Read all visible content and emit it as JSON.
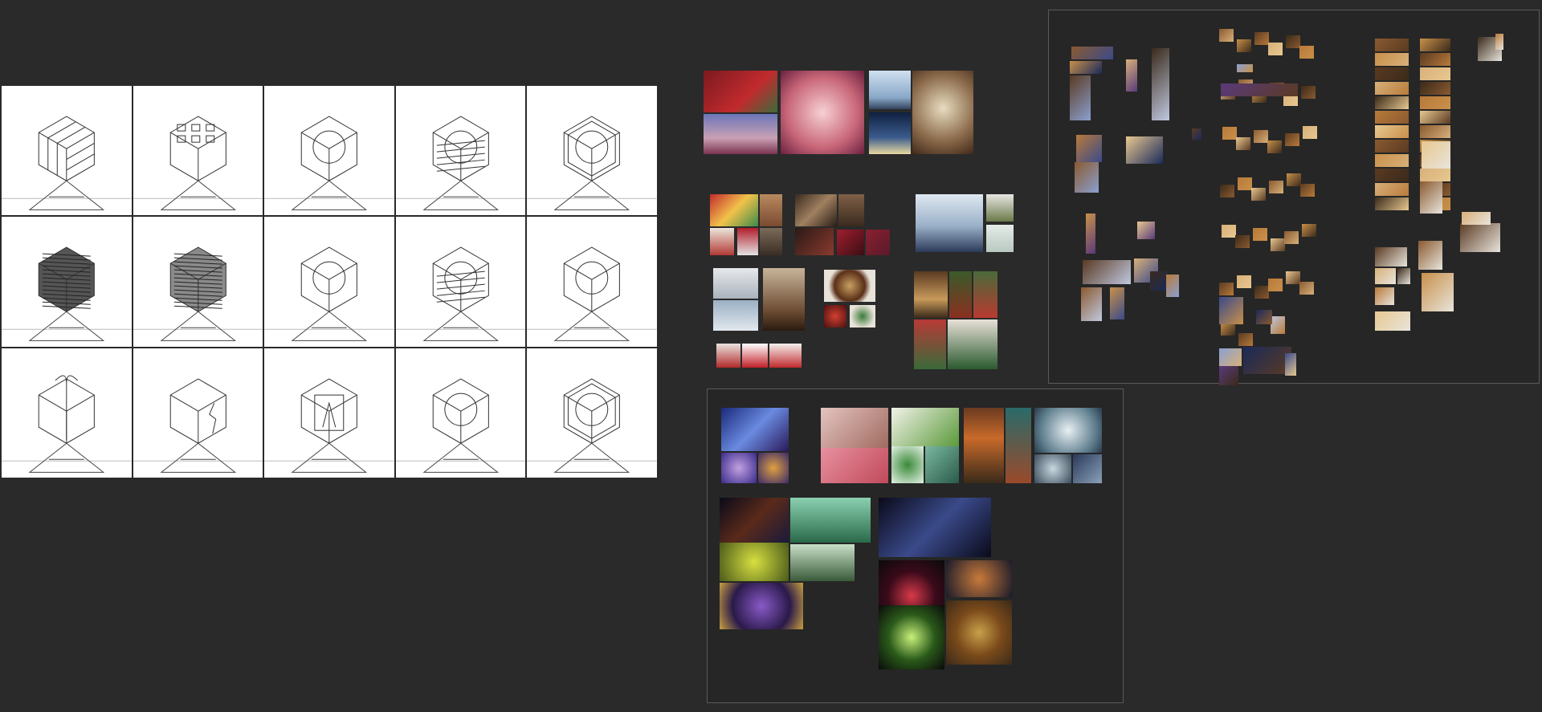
{
  "canvas": {
    "background": "#2a2a2a"
  },
  "sketch_grid": {
    "rows": 3,
    "cols": 5,
    "variants": [
      {
        "style": "rubik"
      },
      {
        "style": "blocks"
      },
      {
        "style": "sphere"
      },
      {
        "style": "sphere-lines"
      },
      {
        "style": "sphere-hex"
      },
      {
        "style": "maze-dark"
      },
      {
        "style": "maze-mid"
      },
      {
        "style": "landscape"
      },
      {
        "style": "forest"
      },
      {
        "style": "ornament"
      },
      {
        "style": "gift-bow"
      },
      {
        "style": "cracked"
      },
      {
        "style": "boxed-figure"
      },
      {
        "style": "snowglobe"
      },
      {
        "style": "hex-snowglobe"
      }
    ]
  },
  "colors": {
    "frame_border": "#5a5a5a",
    "sketch_bg": "#ffffff",
    "sketch_line": "#333333"
  },
  "icons": [
    "photo-thumbnail",
    "sketch-drawing"
  ]
}
